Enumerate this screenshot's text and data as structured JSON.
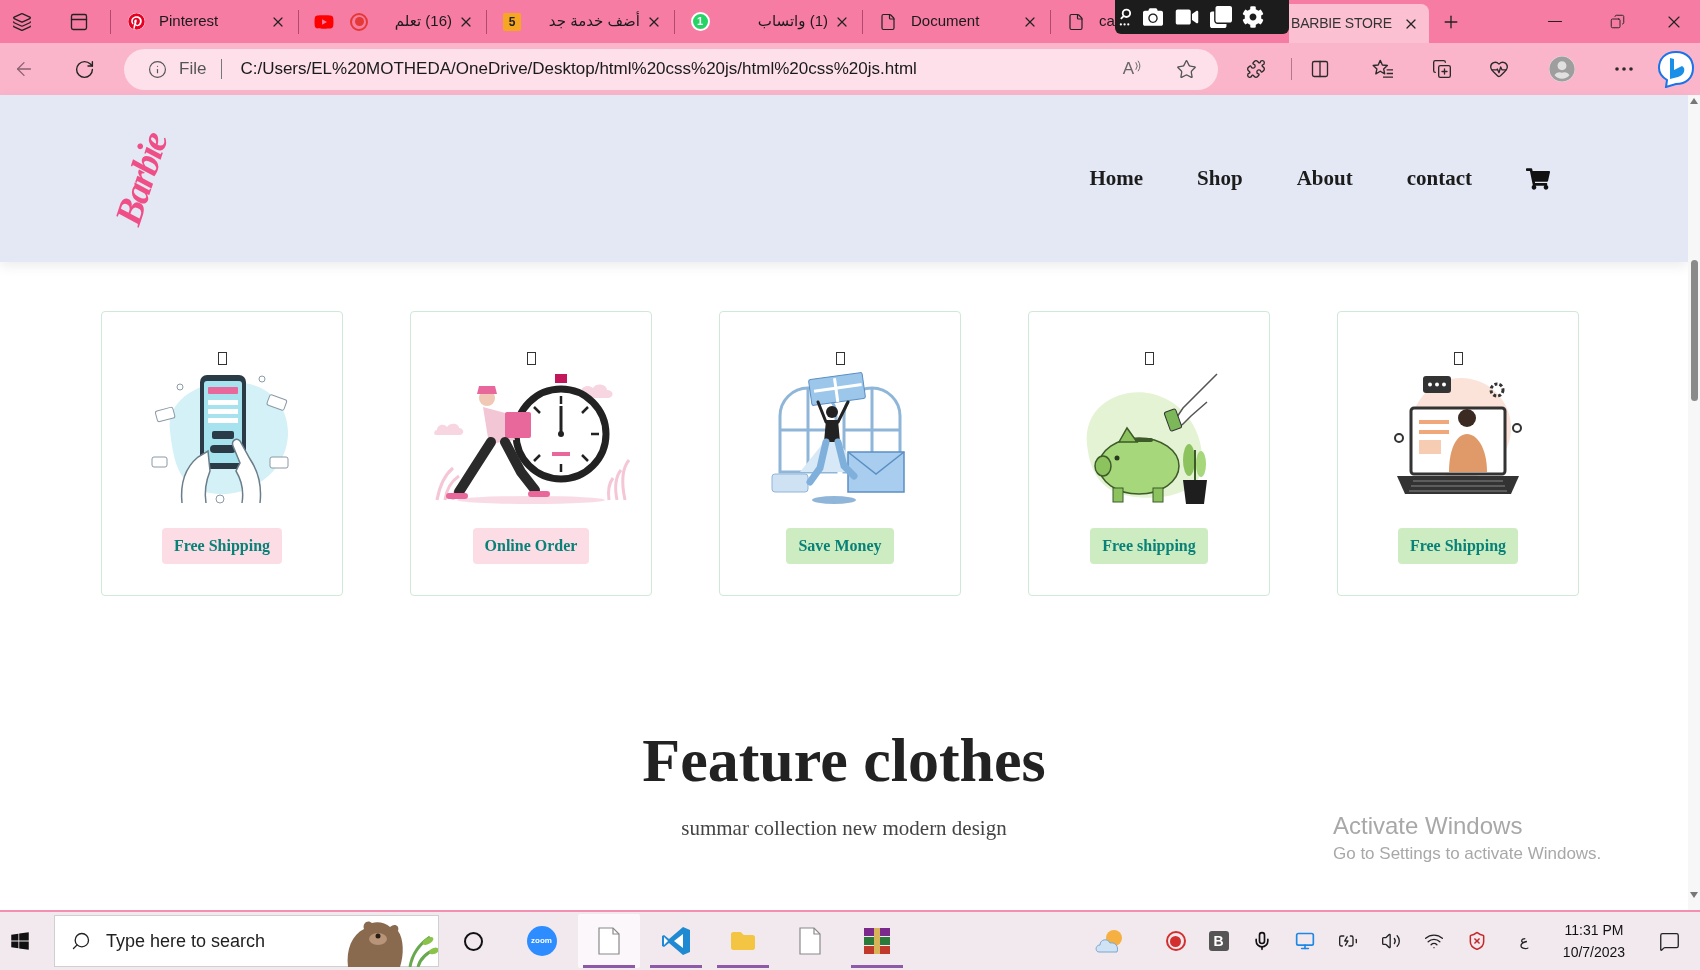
{
  "browser": {
    "tabs": [
      {
        "kind": "pinterest",
        "title": "Pinterest",
        "recording": false,
        "covered": false,
        "selected": false
      },
      {
        "kind": "youtube",
        "title": "(16) تعلم",
        "recording": true,
        "covered": false,
        "selected": false
      },
      {
        "kind": "numbered",
        "badge": "5",
        "title": "أضف خدمة جد",
        "recording": false,
        "covered": false,
        "selected": false
      },
      {
        "kind": "chat",
        "badge": "1",
        "title": "(1) واتساب",
        "recording": false,
        "covered": false,
        "selected": false
      },
      {
        "kind": "document",
        "title": "Document",
        "recording": false,
        "covered": false,
        "selected": false
      },
      {
        "kind": "document",
        "title": "ca",
        "recording": false,
        "covered": true,
        "selected": false
      },
      {
        "kind": "page",
        "title": "BARBIE STORE",
        "recording": false,
        "covered": false,
        "selected": true
      }
    ],
    "address": {
      "scheme": "File",
      "url": "C:/Users/EL%20MOTHEDA/OneDrive/Desktop/html%20css%20js/html%20css%20js.html",
      "read_aloud": "A"
    }
  },
  "site": {
    "logo": "Barbie",
    "nav": [
      "Home",
      "Shop",
      "About",
      "contact"
    ],
    "features": [
      {
        "kind": "payment",
        "label": "Free Shipping",
        "color": "#fcdde5"
      },
      {
        "kind": "delivery",
        "label": "Online Order",
        "color": "#fcdde5"
      },
      {
        "kind": "gift",
        "label": "Save Money",
        "color": "#cdecc1"
      },
      {
        "kind": "savings",
        "label": "Free shipping",
        "color": "#cdecc1"
      },
      {
        "kind": "support",
        "label": "Free Shipping",
        "color": "#cdecc1"
      }
    ],
    "section": {
      "title": "Feature clothes",
      "subtitle": "summar collection new modern design"
    }
  },
  "activation_notice": {
    "title": "Activate Windows",
    "text": "Go to Settings to activate Windows."
  },
  "taskbar": {
    "search": {
      "placeholder": "Type here to search"
    },
    "apps": [
      {
        "kind": "zoom",
        "label": "zoom",
        "running": false,
        "selected": false
      },
      {
        "kind": "document",
        "running": true,
        "selected": true
      },
      {
        "kind": "code",
        "running": true,
        "selected": false
      },
      {
        "kind": "folder",
        "running": true,
        "selected": false
      },
      {
        "kind": "document",
        "running": false,
        "selected": false
      },
      {
        "kind": "archive",
        "running": true,
        "selected": false
      }
    ],
    "tray": {
      "app_letter": "B",
      "language": "ع",
      "time": "11:31 PM",
      "date": "10/7/2023"
    }
  }
}
